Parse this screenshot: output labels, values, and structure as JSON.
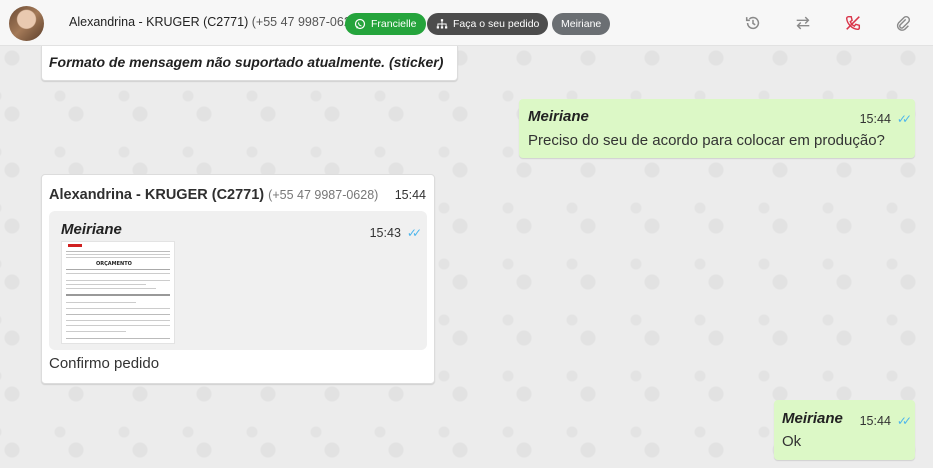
{
  "header": {
    "contact_name": "Alexandrina - KRUGER (C2771)",
    "contact_phone": "(+55 47 9987-0628)",
    "chips": [
      {
        "label": "Francielle",
        "icon": "whatsapp-icon",
        "color": "#25a43c"
      },
      {
        "label": "Faça o seu pedido",
        "icon": "sitemap-icon",
        "color": "#4c4c4c"
      },
      {
        "label": "Meiriane",
        "color": "#6b6f73"
      }
    ],
    "actions": [
      "history-icon",
      "transfer-icon",
      "end-call-icon",
      "attach-icon"
    ]
  },
  "messages": {
    "sticker": {
      "text": "Formato de mensagem não suportado atualmente. (sticker)"
    },
    "out1": {
      "sender": "Meiriane",
      "time": "15:44",
      "text": "Preciso do seu de acordo para colocar em produção?"
    },
    "in2": {
      "header_name": "Alexandrina - KRUGER (C2771)",
      "header_phone": "(+55 47 9987-0628)",
      "time": "15:44",
      "quoted": {
        "sender": "Meiriane",
        "time": "15:43",
        "doc_title": "ORÇAMENTO"
      },
      "caption": "Confirmo pedido"
    },
    "out2": {
      "sender": "Meiriane",
      "time": "15:44",
      "text": "Ok"
    }
  },
  "colors": {
    "outgoing_bubble": "#dcf8c6",
    "incoming_bubble": "#ffffff",
    "read_ticks": "#4fb6ec",
    "end_call": "#d9354a"
  }
}
